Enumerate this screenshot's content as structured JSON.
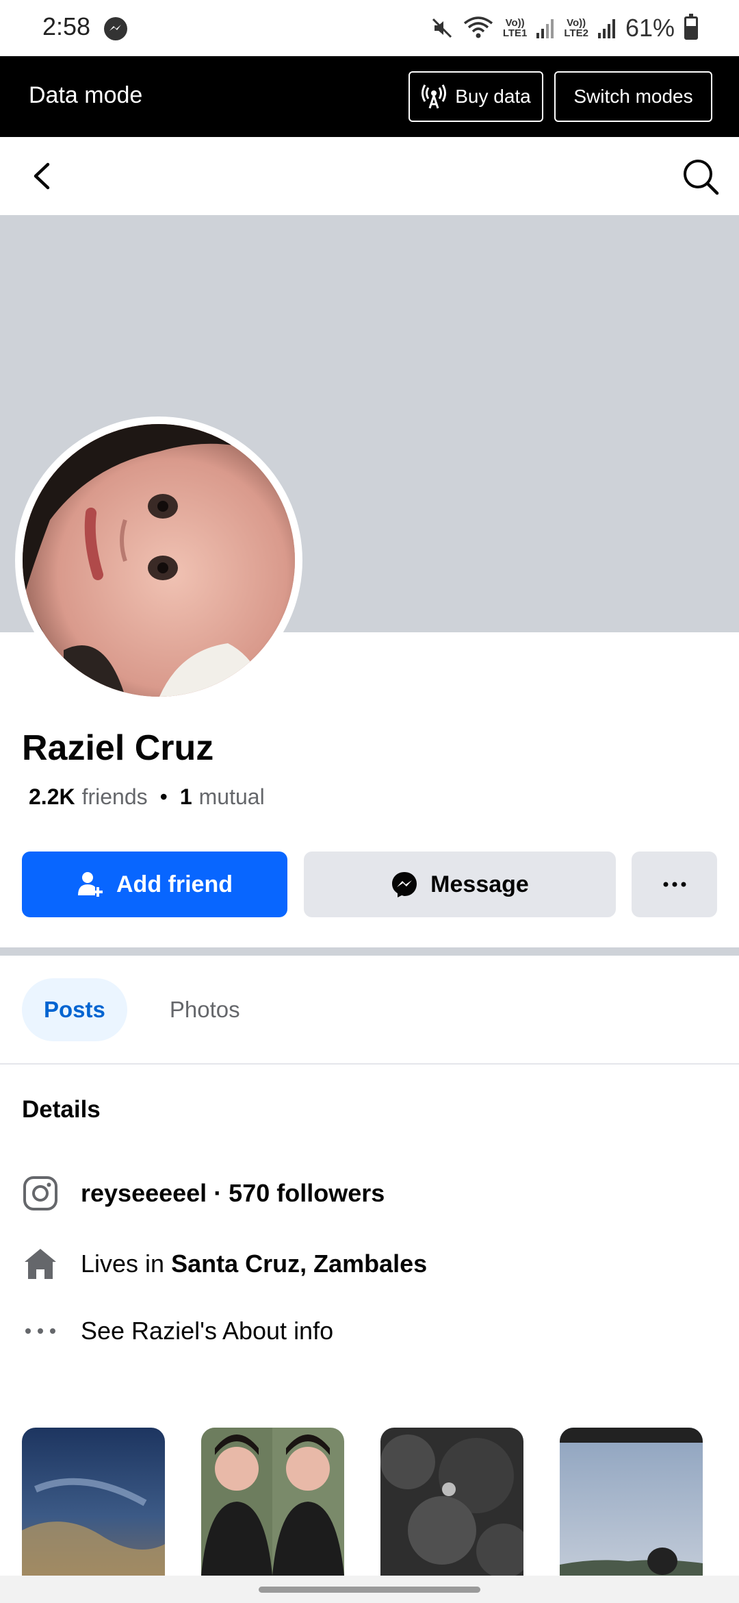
{
  "status_bar": {
    "time": "2:58",
    "sim1_top": "Vo))",
    "sim1_bottom": "LTE1",
    "sim2_top": "Vo))",
    "sim2_bottom": "LTE2",
    "battery": "61%",
    "battery_level": 0.61
  },
  "data_mode": {
    "title": "Data mode",
    "buy_label": "Buy data",
    "switch_label": "Switch modes"
  },
  "profile": {
    "name": "Raziel Cruz",
    "friends_count": "2.2K",
    "friends_label": "friends",
    "separator": "•",
    "mutual_count": "1",
    "mutual_label": "mutual"
  },
  "actions": {
    "add_friend": "Add friend",
    "message": "Message",
    "more": "···"
  },
  "tabs": [
    {
      "label": "Posts",
      "active": true
    },
    {
      "label": "Photos",
      "active": false
    }
  ],
  "details": {
    "title": "Details",
    "instagram_handle": "reyseeeeel",
    "instagram_followers": " · 570 followers",
    "lives_prefix": "Lives in ",
    "lives_place": "Santa Cruz, Zambales",
    "about_link": "See Raziel's About info"
  },
  "colors": {
    "accent": "#0866ff",
    "cover": "#ced2d8",
    "secondary_button": "#e4e6eb",
    "active_tab_bg": "#ebf5ff",
    "active_tab_text": "#0064d1"
  },
  "icons": {
    "status": [
      "messenger-icon",
      "mute-icon",
      "wifi-icon",
      "signal-icon",
      "battery-icon"
    ],
    "buy_data": "antenna-icon",
    "nav": [
      "back-icon",
      "search-icon"
    ],
    "add_friend": "add-person-icon",
    "message": "messenger-icon",
    "details": [
      "instagram-icon",
      "home-icon",
      "more-dots-icon"
    ]
  }
}
